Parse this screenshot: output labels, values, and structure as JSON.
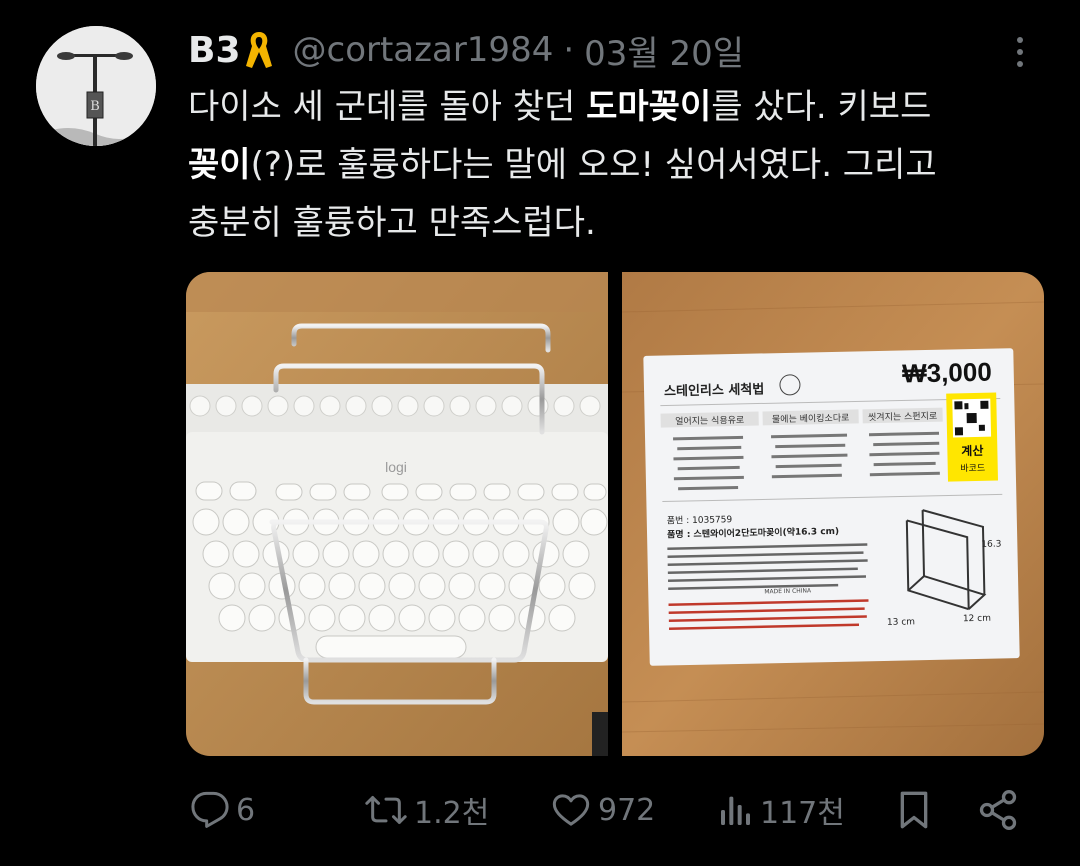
{
  "author": {
    "display_name": "B3",
    "handle": "@cortazar1984",
    "date": "03월 20일",
    "avatar_icon": "street-lamp-photo",
    "badge_icon": "yellow-ribbon-icon"
  },
  "tweet": {
    "text_parts": [
      {
        "t": "다이소 세 군데를 돌아 찾던 ",
        "b": false
      },
      {
        "t": "도마꽂이",
        "b": true
      },
      {
        "t": "를 샀다. 키보드\n",
        "b": false
      },
      {
        "t": "꽂이",
        "b": true
      },
      {
        "t": "(?)로 훌륭하다는 말에 오오! 싶어서였다. 그리고\n충분히 훌륭하고 만족스럽다.",
        "b": false
      }
    ]
  },
  "media": {
    "photo1": {
      "description_icon": "keyboard-with-rack-photo",
      "brand_text": "logi"
    },
    "photo2": {
      "description_icon": "product-label-photo",
      "price": "₩3,000",
      "label_title": "스테인리스 세척법",
      "wash_tabs": [
        "얼어지는 식용유로",
        "물에는 베이킹소다로",
        "씻겨지는 스펀지로"
      ],
      "checkout": "계산",
      "barcode": "바코드",
      "product_no": "품번 : 1035759",
      "product_name": "품명 : 스텐와이어2단도마꽂이(약16.3 cm)",
      "dims": [
        "16.3",
        "12 cm",
        "13 cm"
      ],
      "origin": "MADE IN CHINA"
    }
  },
  "actions": {
    "reply": {
      "icon": "reply-icon",
      "count": "6"
    },
    "retweet": {
      "icon": "retweet-icon",
      "count": "1.2천"
    },
    "like": {
      "icon": "heart-icon",
      "count": "972"
    },
    "views": {
      "icon": "views-bar-chart-icon",
      "count": "117천"
    },
    "bookmark": {
      "icon": "bookmark-icon"
    },
    "share": {
      "icon": "share-icon"
    }
  },
  "colors": {
    "background": "#000000",
    "text": "#e7e9ea",
    "muted": "#71767b",
    "ribbon": "#f4b400",
    "barcode_yellow": "#ffe600"
  }
}
